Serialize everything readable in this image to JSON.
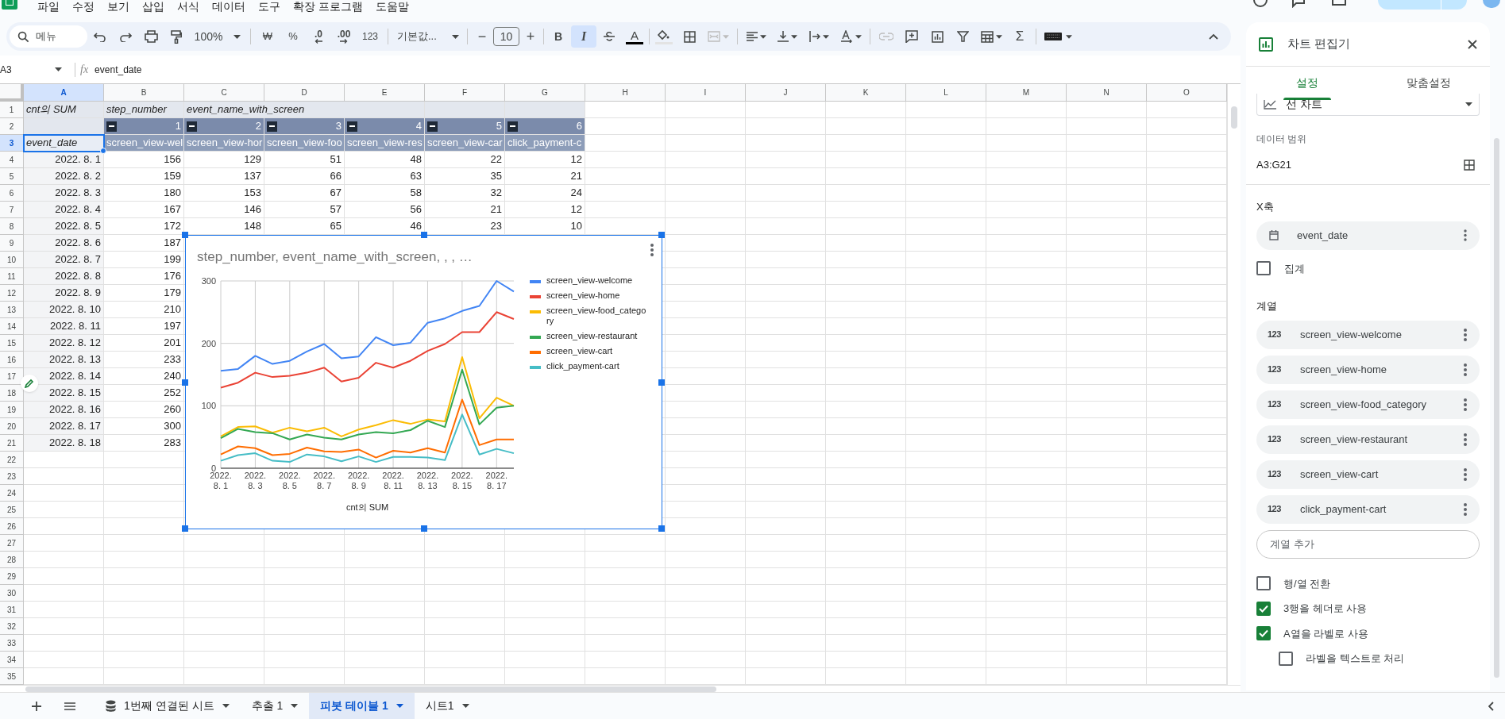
{
  "menu": [
    "파일",
    "수정",
    "보기",
    "삽입",
    "서식",
    "데이터",
    "도구",
    "확장 프로그램",
    "도움말"
  ],
  "toolbar": {
    "search_label": "메뉴",
    "zoom": "100%",
    "currency": "₩",
    "percent": "%",
    "decimal_decrease": ".0",
    "decimal_increase": ".00",
    "number_format": "123",
    "font": "기본값...",
    "font_minus": "−",
    "font_size": "10",
    "font_plus": "+",
    "bold": {
      "label": "B",
      "selected": false
    },
    "italic": {
      "label": "I",
      "selected": true
    },
    "text_color": "A",
    "sum": "Σ"
  },
  "formula_bar": {
    "name_box": "A3",
    "fx": "fx",
    "value": "event_date"
  },
  "sheet": {
    "columns": [
      "A",
      "B",
      "C",
      "D",
      "E",
      "F",
      "G",
      "H",
      "I",
      "J",
      "K",
      "L",
      "M",
      "N",
      "O"
    ],
    "row_headers": [
      "1",
      "2",
      "3",
      "4",
      "5",
      "6",
      "7",
      "8",
      "9",
      "10",
      "11",
      "12",
      "13",
      "14",
      "15",
      "16",
      "17",
      "18",
      "19",
      "20",
      "21",
      "22",
      "23",
      "24",
      "25",
      "26",
      "27",
      "28",
      "29",
      "30",
      "31",
      "32",
      "33",
      "34",
      "35"
    ]
  },
  "pivot": {
    "value_label": "cnt의 SUM",
    "rows_label": "step_number",
    "columns_label": "event_name_with_screen",
    "step_numbers": [
      "1",
      "2",
      "3",
      "4",
      "5",
      "6"
    ],
    "row_header": "event_date",
    "column_headers": [
      "screen_view-wel",
      "screen_view-hor",
      "screen_view-foo",
      "screen_view-res",
      "screen_view-car",
      "click_payment-c"
    ],
    "rows": [
      {
        "date": "2022. 8. 1",
        "values": [
          "156",
          "129",
          "51",
          "48",
          "22",
          "12"
        ]
      },
      {
        "date": "2022. 8. 2",
        "values": [
          "159",
          "137",
          "66",
          "63",
          "35",
          "21"
        ]
      },
      {
        "date": "2022. 8. 3",
        "values": [
          "180",
          "153",
          "67",
          "58",
          "32",
          "24"
        ]
      },
      {
        "date": "2022. 8. 4",
        "values": [
          "167",
          "146",
          "57",
          "56",
          "21",
          "12"
        ]
      },
      {
        "date": "2022. 8. 5",
        "values": [
          "172",
          "148",
          "65",
          "46",
          "23",
          "10"
        ]
      },
      {
        "date": "2022. 8. 6",
        "values": [
          "187"
        ]
      },
      {
        "date": "2022. 8. 7",
        "values": [
          "199"
        ]
      },
      {
        "date": "2022. 8. 8",
        "values": [
          "176"
        ]
      },
      {
        "date": "2022. 8. 9",
        "values": [
          "179"
        ]
      },
      {
        "date": "2022. 8. 10",
        "values": [
          "210"
        ]
      },
      {
        "date": "2022. 8. 11",
        "values": [
          "197"
        ]
      },
      {
        "date": "2022. 8. 12",
        "values": [
          "201"
        ]
      },
      {
        "date": "2022. 8. 13",
        "values": [
          "233"
        ]
      },
      {
        "date": "2022. 8. 14",
        "values": [
          "240"
        ]
      },
      {
        "date": "2022. 8. 15",
        "values": [
          "252"
        ]
      },
      {
        "date": "2022. 8. 16",
        "values": [
          "260"
        ]
      },
      {
        "date": "2022. 8. 17",
        "values": [
          "300"
        ]
      },
      {
        "date": "2022. 8. 18",
        "values": [
          "283"
        ]
      }
    ]
  },
  "chart": {
    "chart_data": {
      "type": "line",
      "title": "step_number, event_name_with_screen, , , …",
      "xlabel": "cnt의 SUM",
      "categories": [
        "2022. 8. 1",
        null,
        "2022. 8. 3",
        null,
        "2022. 8. 5",
        null,
        "2022. 8. 7",
        null,
        "2022. 8. 9",
        null,
        "2022. 8. 11",
        null,
        "2022. 8. 13",
        null,
        "2022. 8. 15",
        null,
        "2022. 8. 17",
        null
      ],
      "grid": true,
      "legend": true,
      "ylim": [
        0,
        300
      ],
      "yticks": [
        0,
        100,
        200,
        300
      ],
      "series": [
        {
          "name": "screen_view-welcome",
          "color": "#4285f4",
          "values": [
            156,
            159,
            180,
            167,
            172,
            187,
            199,
            176,
            179,
            210,
            197,
            201,
            233,
            240,
            252,
            260,
            300,
            283
          ]
        },
        {
          "name": "screen_view-home",
          "color": "#ea4335",
          "values": [
            129,
            137,
            153,
            146,
            148,
            153,
            161,
            139,
            145,
            169,
            161,
            172,
            188,
            199,
            218,
            218,
            250,
            239
          ]
        },
        {
          "name": "screen_view-food_category",
          "color": "#fbbc04",
          "values": [
            51,
            66,
            67,
            57,
            65,
            59,
            65,
            51,
            62,
            69,
            77,
            71,
            78,
            75,
            178,
            80,
            113,
            100
          ]
        },
        {
          "name": "screen_view-restaurant",
          "color": "#34a853",
          "values": [
            48,
            63,
            58,
            56,
            46,
            54,
            49,
            46,
            54,
            58,
            56,
            61,
            76,
            66,
            158,
            70,
            97,
            100
          ]
        },
        {
          "name": "screen_view-cart",
          "color": "#ff6d01",
          "values": [
            22,
            35,
            32,
            21,
            23,
            33,
            27,
            26,
            30,
            17,
            28,
            25,
            32,
            25,
            110,
            37,
            46,
            46
          ]
        },
        {
          "name": "click_payment-cart",
          "color": "#46bdc6",
          "values": [
            12,
            21,
            24,
            12,
            10,
            22,
            19,
            11,
            19,
            10,
            18,
            18,
            17,
            13,
            86,
            22,
            31,
            24
          ]
        }
      ]
    }
  },
  "chart_editor": {
    "title": "차트 편집기",
    "tabs": [
      {
        "label": "설정",
        "selected": true
      },
      {
        "label": "맞춤설정",
        "selected": false
      }
    ],
    "chart_type": "선 차트",
    "data_range_label": "데이터 범위",
    "data_range": "A3:G21",
    "x_axis_label": "X축",
    "x_axis_field": "event_date",
    "aggregate": {
      "label": "집계",
      "checked": false
    },
    "series_label": "계열",
    "series": [
      {
        "type": "123",
        "name": "screen_view-welcome"
      },
      {
        "type": "123",
        "name": "screen_view-home"
      },
      {
        "type": "123",
        "name": "screen_view-food_category"
      },
      {
        "type": "123",
        "name": "screen_view-restaurant"
      },
      {
        "type": "123",
        "name": "screen_view-cart"
      },
      {
        "type": "123",
        "name": "click_payment-cart"
      }
    ],
    "add_series": "계열 추가",
    "options": [
      {
        "label": "행/열 전환",
        "checked": false
      },
      {
        "label": "3행을 헤더로 사용",
        "checked": true
      },
      {
        "label": "A열을 라벨로 사용",
        "checked": true,
        "children": [
          {
            "label": "라벨을 텍스트로 처리",
            "checked": false
          }
        ]
      }
    ]
  },
  "sheet_tabs": [
    {
      "label": "1번째 연결된 시트",
      "kind": "connected",
      "selected": false
    },
    {
      "label": "추출 1",
      "kind": "plain",
      "selected": false
    },
    {
      "label": "피봇 테이블 1",
      "kind": "plain",
      "selected": true
    },
    {
      "label": "시트1",
      "kind": "plain",
      "selected": false
    }
  ]
}
